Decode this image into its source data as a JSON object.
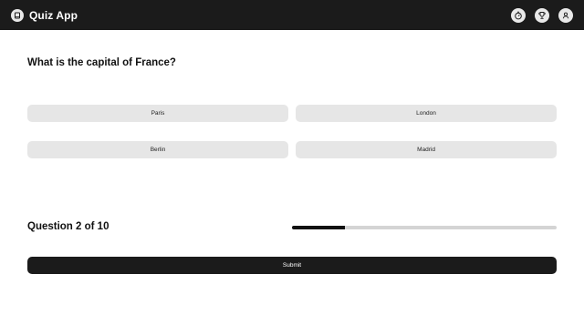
{
  "header": {
    "app_title": "Quiz App",
    "icons": [
      "book-icon",
      "timer-icon",
      "trophy-icon",
      "profile-icon"
    ],
    "background": "#1b1b1b"
  },
  "quiz": {
    "question": "What is the capital of France?",
    "options": [
      "Paris",
      "London",
      "Berlin",
      "Madrid"
    ]
  },
  "progress": {
    "label": "Question 2 of 10",
    "current": 2,
    "total": 10,
    "fraction": 0.2
  },
  "actions": {
    "submit_label": "Submit"
  }
}
